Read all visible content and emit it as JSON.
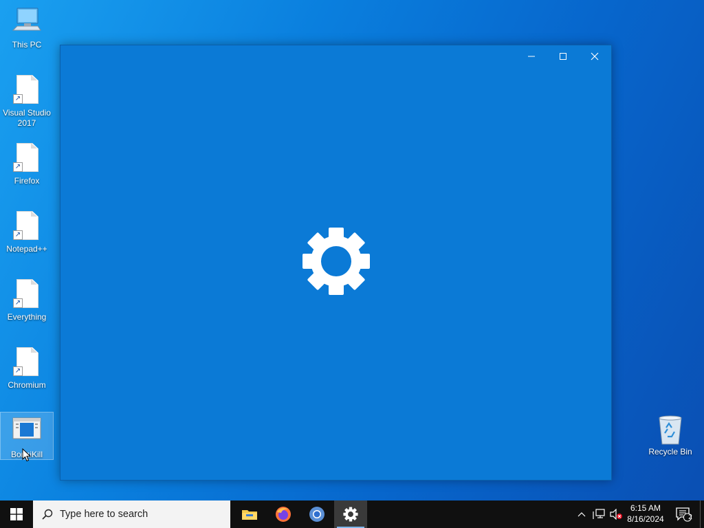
{
  "desktop": {
    "icons": [
      {
        "label": "This PC",
        "icon": "this-pc-icon"
      },
      {
        "label": "Visual Studio 2017",
        "icon": "file-shortcut-icon"
      },
      {
        "label": "Firefox",
        "icon": "file-shortcut-icon"
      },
      {
        "label": "Notepad++",
        "icon": "file-shortcut-icon"
      },
      {
        "label": "Everything",
        "icon": "file-shortcut-icon"
      },
      {
        "label": "Chromium",
        "icon": "file-shortcut-icon"
      },
      {
        "label": "BonziKill",
        "icon": "bonzikill-icon",
        "selected": true
      },
      {
        "label": "Recycle Bin",
        "icon": "recycle-bin-icon"
      }
    ]
  },
  "window": {
    "app": "Settings",
    "splash_icon": "gear-icon",
    "background": "#0b7ad6",
    "controls": [
      "minimize",
      "maximize",
      "close"
    ]
  },
  "taskbar": {
    "search": {
      "placeholder": "Type here to search"
    },
    "apps": [
      {
        "name": "File Explorer",
        "icon": "folder-icon",
        "active": false
      },
      {
        "name": "Firefox",
        "icon": "firefox-icon",
        "active": false
      },
      {
        "name": "Chromium",
        "icon": "chromium-icon",
        "active": false
      },
      {
        "name": "Settings",
        "icon": "gear-icon",
        "active": true
      }
    ],
    "tray": {
      "time": "6:15 AM",
      "date": "8/16/2024",
      "notification_count": "2"
    }
  },
  "colors": {
    "accent": "#0078d7",
    "taskbar": "#101010",
    "search_bg": "#f3f3f3"
  }
}
